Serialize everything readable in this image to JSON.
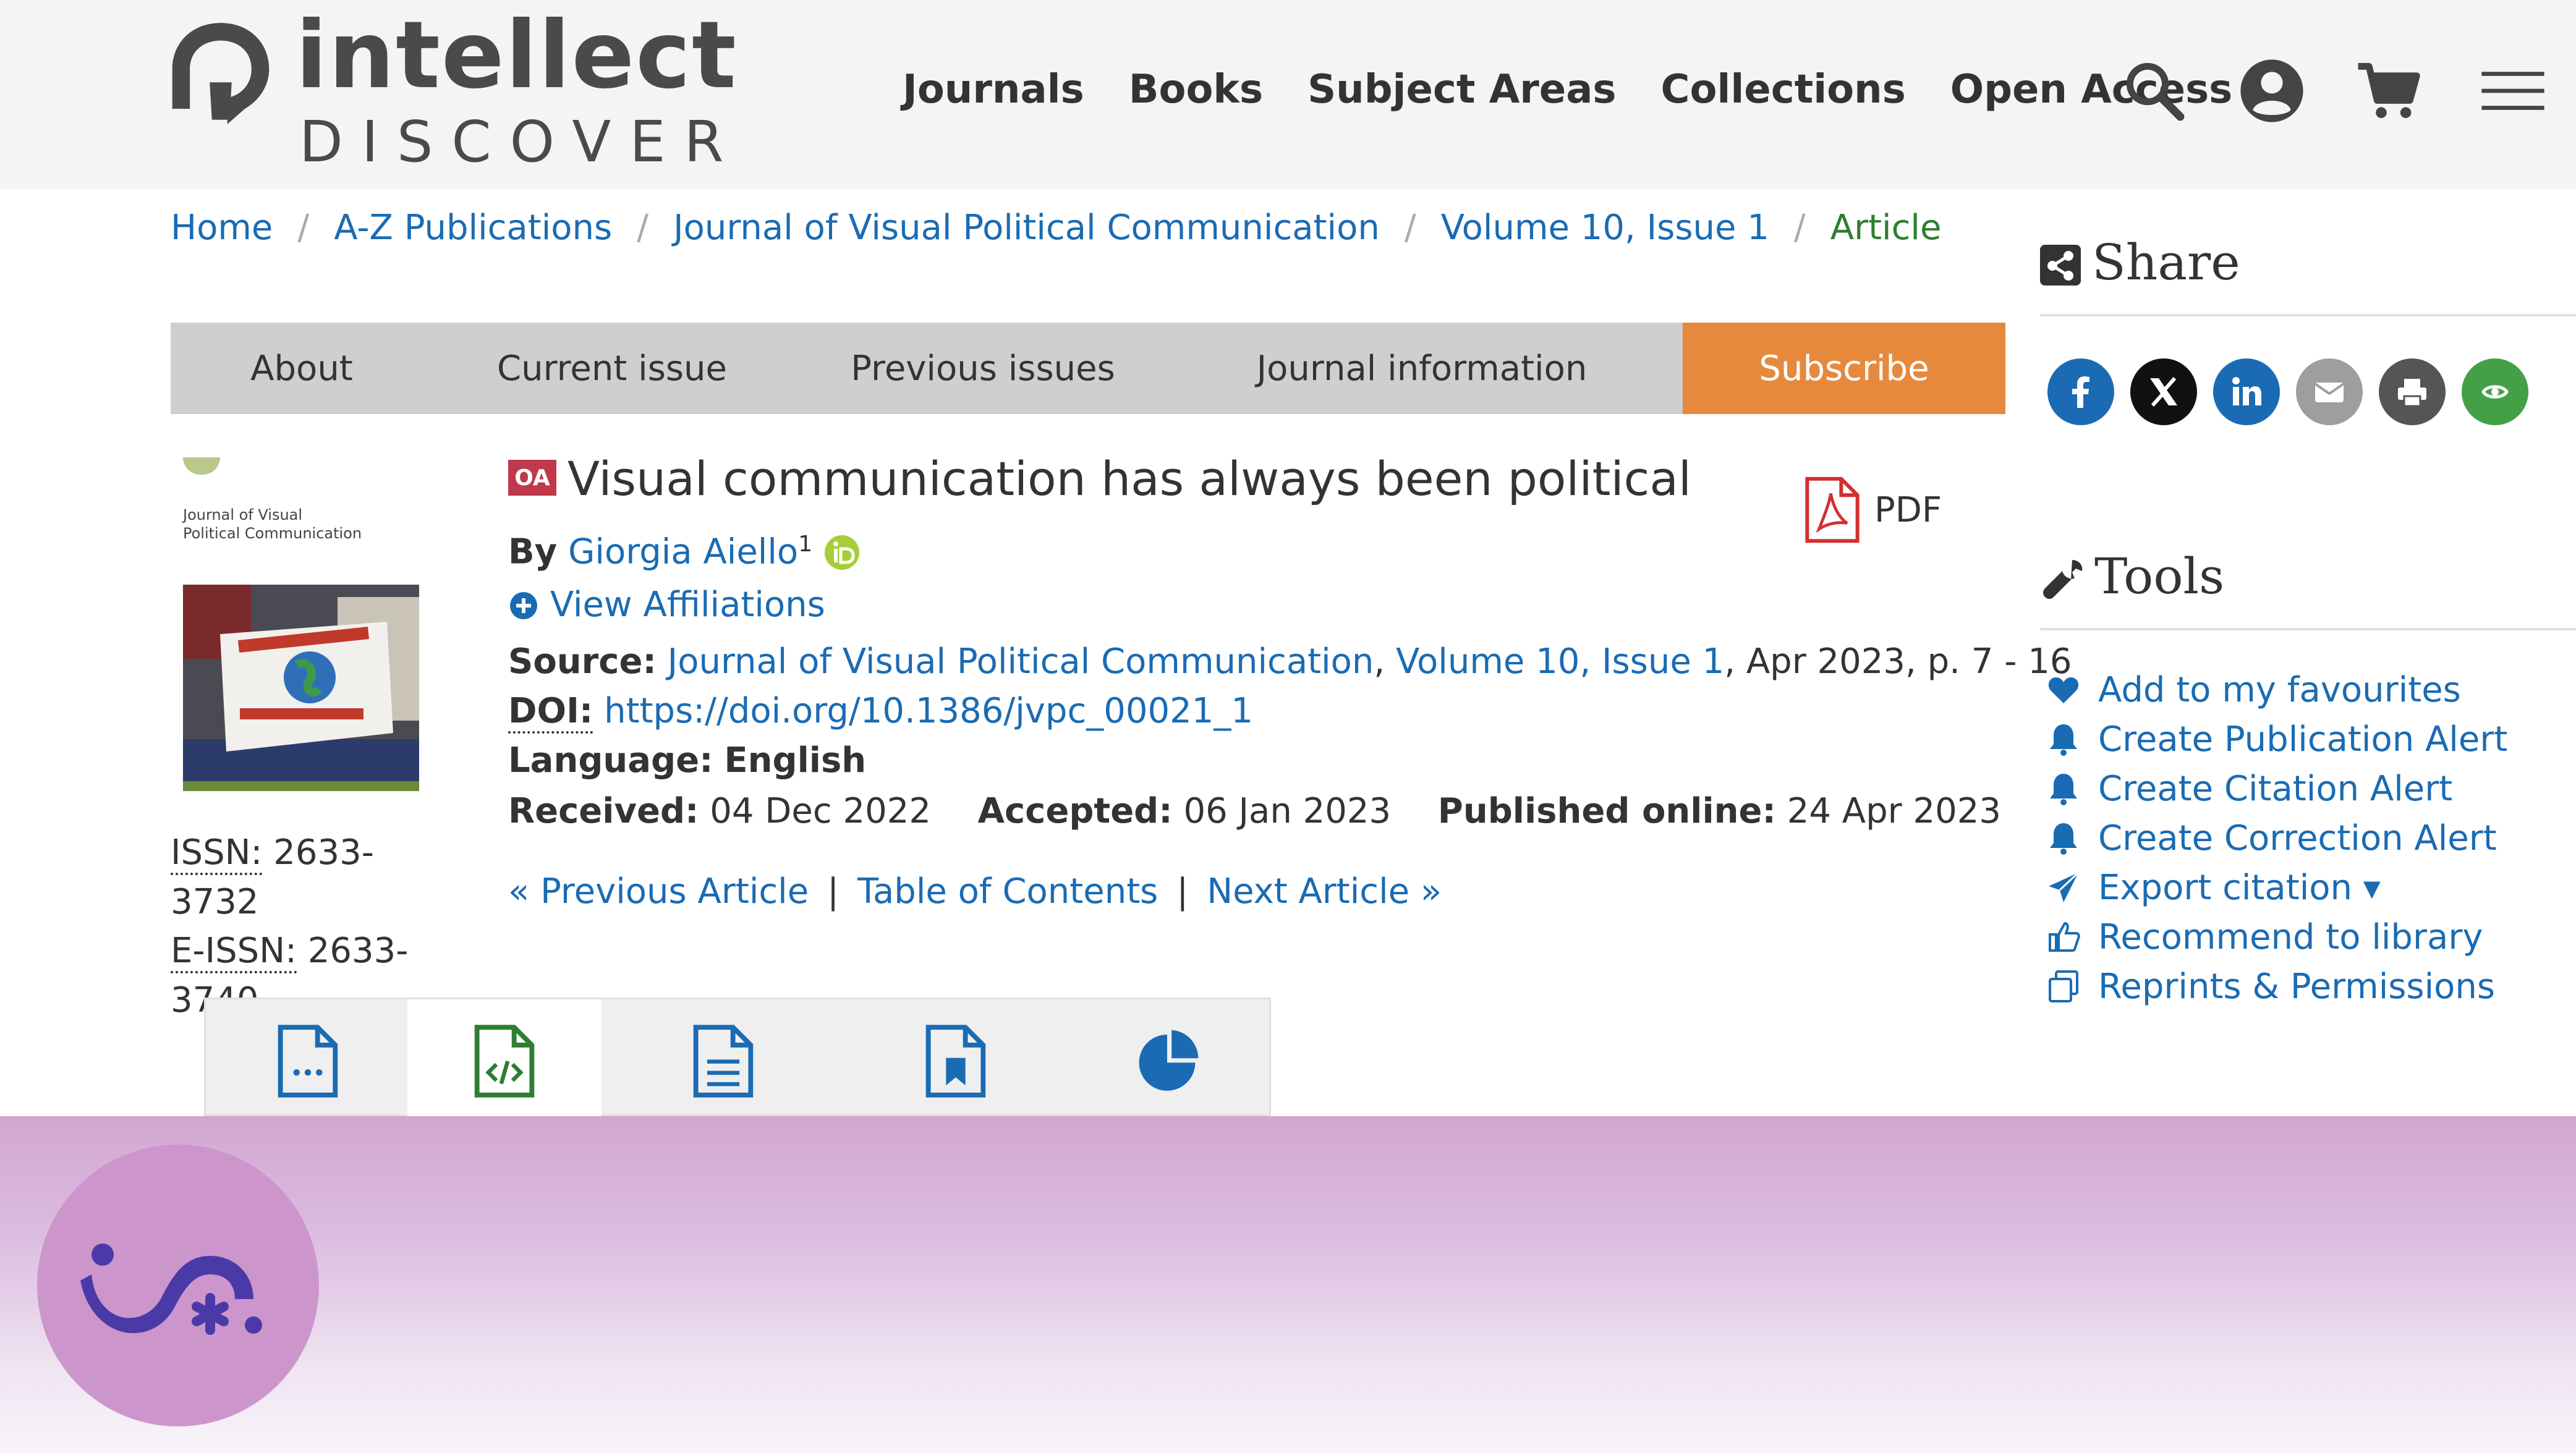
{
  "header": {
    "logo_word": "intellect",
    "logo_sub": "DISCOVER",
    "nav": [
      "Journals",
      "Books",
      "Subject Areas",
      "Collections",
      "Open Access"
    ]
  },
  "breadcrumb": [
    "Home",
    "A-Z Publications",
    "Journal of Visual Political Communication",
    "Volume 10, Issue 1",
    "Article"
  ],
  "tabs": {
    "about": "About",
    "current": "Current issue",
    "previous": "Previous issues",
    "info": "Journal information",
    "subscribe": "Subscribe"
  },
  "cover": {
    "title_line1": "Journal of Visual",
    "title_line2": "Political Communication"
  },
  "issn": {
    "issn_label": "ISSN:",
    "issn_value": "2633-3732",
    "eissn_label": "E-ISSN:",
    "eissn_value": "2633-3740"
  },
  "article": {
    "badge": "OA",
    "title": "Visual communication has always been political",
    "pdf_label": "PDF",
    "by_label": "By",
    "author": "Giorgia Aiello",
    "author_sup": "1",
    "view_affiliations": "View Affiliations",
    "source_label": "Source:",
    "source_journal": "Journal of Visual Political Communication",
    "source_comma": ",",
    "source_issue": "Volume 10, Issue 1",
    "source_rest": ", Apr 2023, p. 7 - 16",
    "doi_label": "DOI:",
    "doi": "https://doi.org/10.1386/jvpc_00021_1",
    "language_label": "Language:",
    "language": "English",
    "received_label": "Received:",
    "received": "04 Dec 2022",
    "accepted_label": "Accepted:",
    "accepted": "06 Jan 2023",
    "published_label": "Published online:",
    "published": "24 Apr 2023"
  },
  "article_nav": {
    "prev": "« Previous Article",
    "sep": "|",
    "toc": "Table of Contents",
    "next": "Next Article »"
  },
  "sidebar": {
    "share_title": "Share",
    "tools_title": "Tools",
    "tools": [
      "Add to my favourites",
      "Create Publication Alert",
      "Create Citation Alert",
      "Create Correction Alert",
      "Export citation ▾",
      "Recommend to library",
      "Reprints & Permissions"
    ]
  },
  "colors": {
    "link": "#1a6bb3",
    "subscribe": "#e6893d",
    "oa": "#c0394b",
    "current_crumb": "#2e7d32"
  }
}
